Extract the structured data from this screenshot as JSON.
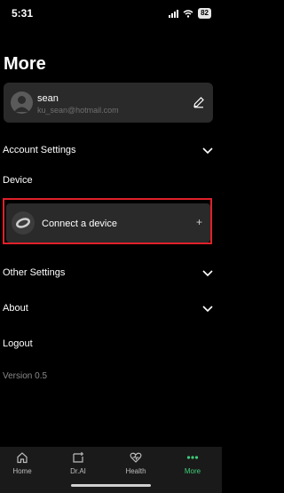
{
  "status_bar": {
    "time": "5:31",
    "battery": "82"
  },
  "page": {
    "title": "More"
  },
  "profile": {
    "name": "sean",
    "email": "ku_sean@hotmail.com"
  },
  "menu": {
    "account_settings": "Account Settings",
    "device": "Device",
    "other_settings": "Other Settings",
    "about": "About",
    "logout": "Logout"
  },
  "device_card": {
    "label": "Connect a device",
    "action": "+"
  },
  "version": "Version 0.5",
  "tabs": [
    {
      "label": "Home",
      "icon": "home-icon"
    },
    {
      "label": "Dr.AI",
      "icon": "dr-ai-icon"
    },
    {
      "label": "Health",
      "icon": "health-icon"
    },
    {
      "label": "More",
      "icon": "more-icon",
      "active": true
    }
  ],
  "colors": {
    "accent": "#3fce7a",
    "highlight": "#e0202a",
    "card": "#2a2a2a"
  }
}
